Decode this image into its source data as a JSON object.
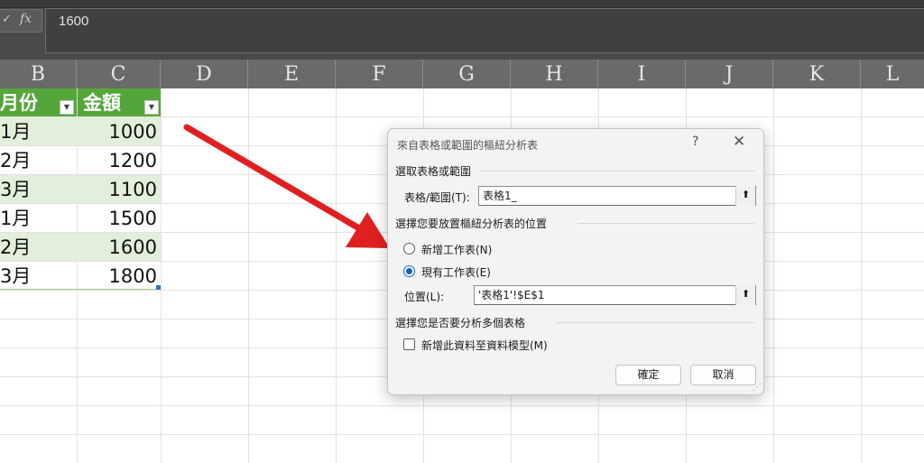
{
  "formula_bar": {
    "cancel_icon": "x-icon",
    "fx_label": "fx",
    "value": "1600"
  },
  "columns": [
    "B",
    "C",
    "D",
    "E",
    "F",
    "G",
    "H",
    "I",
    "J",
    "K",
    "L"
  ],
  "table": {
    "headers": [
      "月份",
      "金額"
    ],
    "rows": [
      [
        "1月",
        "1000"
      ],
      [
        "2月",
        "1200"
      ],
      [
        "3月",
        "1100"
      ],
      [
        "1月",
        "1500"
      ],
      [
        "2月",
        "1600"
      ],
      [
        "3月",
        "1800"
      ]
    ],
    "header_color": "#55a63a",
    "band_color": "#e2efda"
  },
  "annotation": {
    "arrow_color": "#e02020"
  },
  "dialog": {
    "title": "來自表格或範圍的樞紐分析表",
    "help": "?",
    "close": "✕",
    "section1": "選取表格或範圍",
    "range_label": "表格/範圍(T):",
    "range_value": "表格1_",
    "section2": "選擇您要放置樞紐分析表的位置",
    "option_new": "新增工作表(N)",
    "option_existing": "現有工作表(E)",
    "location_label": "位置(L):",
    "location_value": "'表格1'!$E$1",
    "section3": "選擇您是否要分析多個表格",
    "add_model_label": "新增此資料至資料模型(M)",
    "ok": "確定",
    "cancel": "取消",
    "selected_option": "existing"
  }
}
